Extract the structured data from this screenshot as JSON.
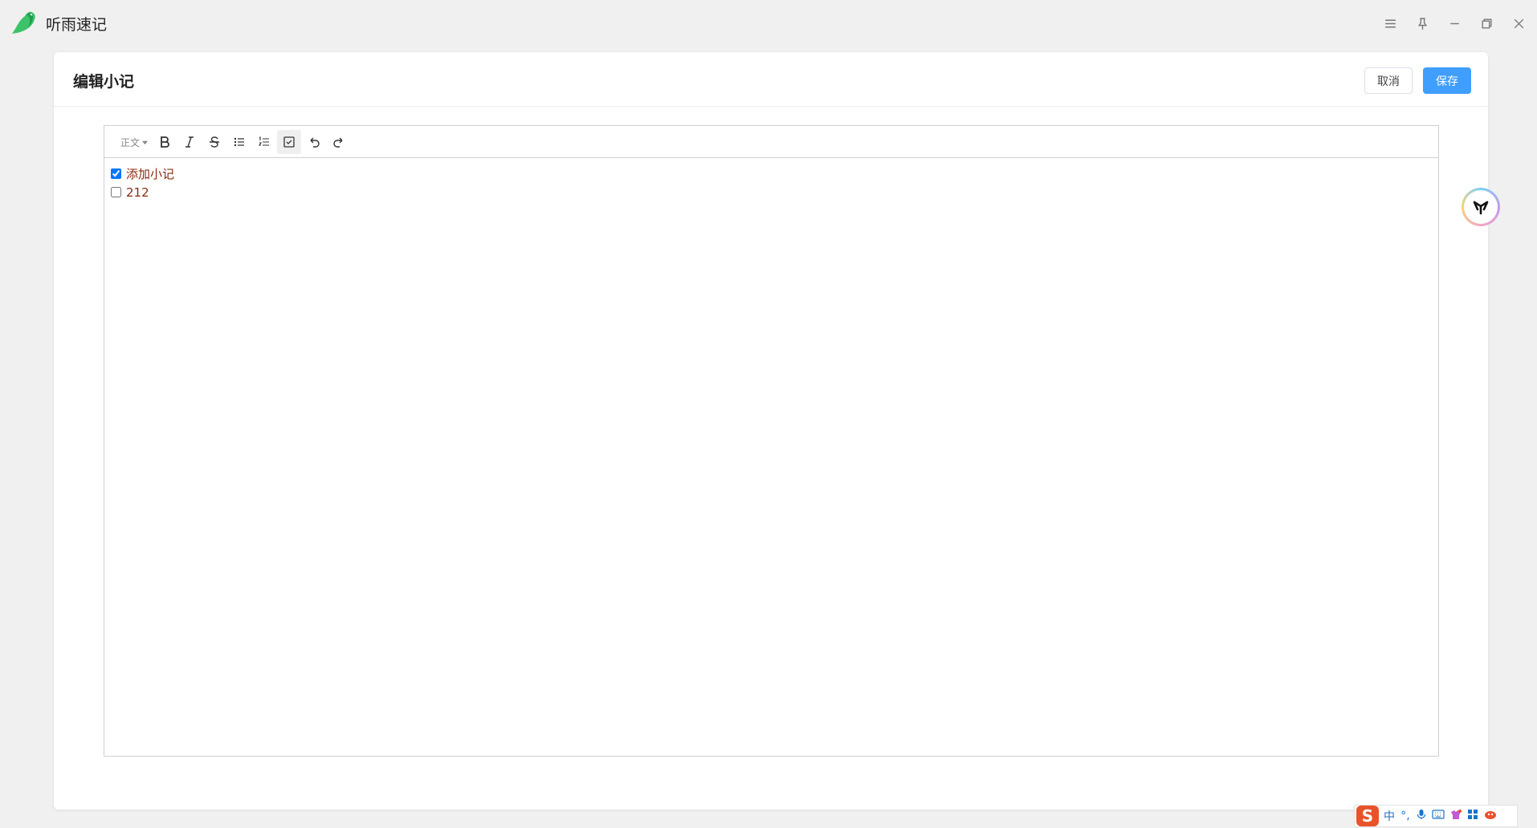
{
  "app": {
    "title": "听雨速记"
  },
  "card": {
    "title": "编辑小记",
    "cancel_label": "取消",
    "save_label": "保存"
  },
  "toolbar": {
    "heading_label": "正文"
  },
  "todos": [
    {
      "text": "添加小记",
      "checked": true
    },
    {
      "text": "212",
      "checked": false
    }
  ],
  "ime": {
    "mode_label": "中",
    "punct_label": "°,"
  },
  "colors": {
    "accent": "#409eff",
    "todo_text": "#8b2a12",
    "logo_green": "#3cc36a",
    "ime_orange": "#e8532c"
  }
}
